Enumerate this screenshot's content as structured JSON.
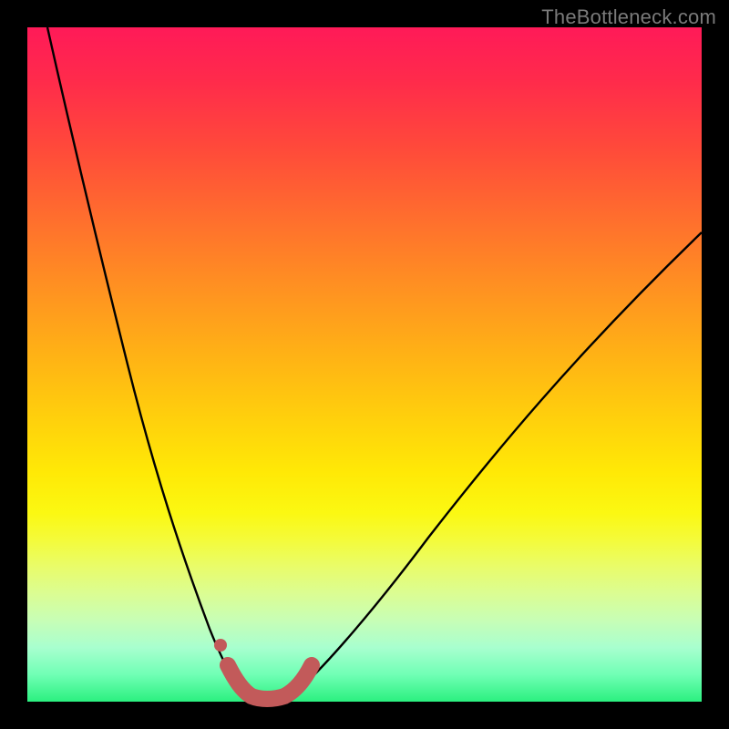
{
  "watermark": "TheBottleneck.com",
  "chart_data": {
    "type": "line",
    "title": "",
    "xlabel": "",
    "ylabel": "",
    "xlim": [
      0,
      100
    ],
    "ylim": [
      0,
      100
    ],
    "series": [
      {
        "name": "bottleneck-curve",
        "color": "#000000",
        "x": [
          3,
          5,
          7,
          9,
          11,
          13,
          15,
          17,
          19,
          21,
          23,
          25,
          27,
          29,
          31,
          33,
          35,
          37,
          40,
          45,
          50,
          55,
          60,
          65,
          70,
          75,
          80,
          85,
          90,
          95,
          100
        ],
        "y": [
          100,
          92,
          84,
          76,
          68,
          60,
          52,
          45,
          38,
          31,
          25,
          19,
          14,
          10,
          6,
          3,
          1.5,
          0.5,
          2,
          6,
          11,
          17,
          23,
          29,
          35,
          41,
          47,
          53,
          59,
          64,
          69
        ]
      },
      {
        "name": "highlight-near-min",
        "color": "#c25a5a",
        "x": [
          28,
          29,
          30,
          31,
          32,
          33,
          34,
          35,
          36,
          37,
          38,
          39,
          40,
          41
        ],
        "y": [
          8,
          6,
          4,
          2.5,
          1.5,
          1,
          0.8,
          0.8,
          1,
          1.5,
          2.2,
          3,
          4,
          5.2
        ]
      }
    ],
    "markers": [
      {
        "name": "highlight-dot",
        "x": 28,
        "y": 11,
        "color": "#c25a5a"
      }
    ],
    "gradient_stops": [
      {
        "pos": 0,
        "color": "#ff1a58"
      },
      {
        "pos": 50,
        "color": "#ffd00c"
      },
      {
        "pos": 75,
        "color": "#f4fb3a"
      },
      {
        "pos": 100,
        "color": "#2bf07f"
      }
    ]
  }
}
